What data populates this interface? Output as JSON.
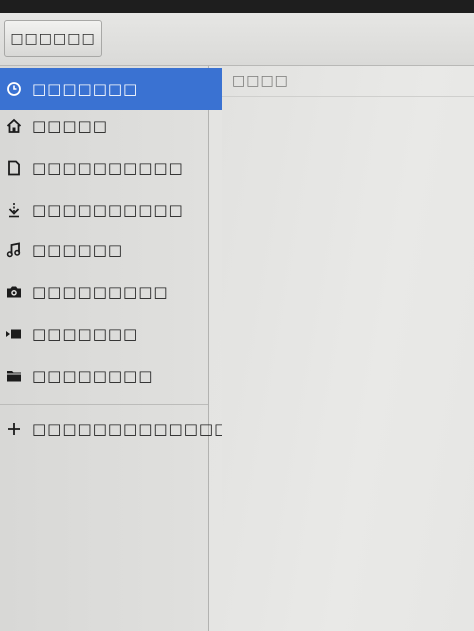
{
  "toolbar": {
    "open_button_label": "□□□□□□"
  },
  "sidebar": {
    "items": [
      {
        "label": "□□□□□□□",
        "icon": "recent-clock-icon",
        "selected": true
      },
      {
        "label": "□□□□□",
        "icon": "home-icon",
        "selected": false
      },
      {
        "label": "□□□□□□□□□□",
        "icon": "documents-icon",
        "selected": false
      },
      {
        "label": "□□□□□□□□□□",
        "icon": "downloads-icon",
        "selected": false
      },
      {
        "label": "□□□□□□",
        "icon": "music-icon",
        "selected": false
      },
      {
        "label": "□□□□□□□□□",
        "icon": "camera-icon",
        "selected": false
      },
      {
        "label": "□□□□□□□",
        "icon": "video-icon",
        "selected": false
      },
      {
        "label": "□□□□□□□□",
        "icon": "folder-icon",
        "selected": false
      }
    ],
    "other_locations": {
      "label": "□□□□□□□□□□□□□□□",
      "icon": "plus-icon"
    }
  },
  "main": {
    "header_label": "□□□□"
  },
  "colors": {
    "selection": "#3a72d2",
    "selected_text": "#ffffff",
    "text": "#1c1c1c"
  }
}
